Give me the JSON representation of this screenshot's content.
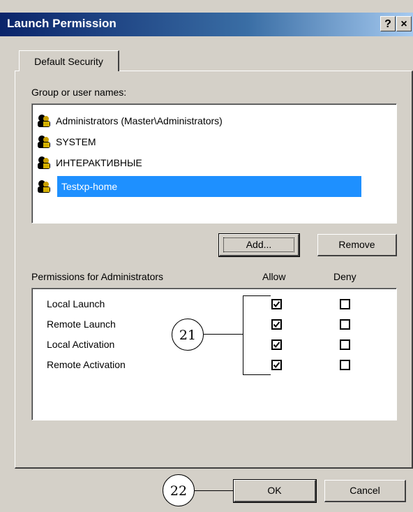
{
  "window": {
    "title": "Launch Permission",
    "help_button": "?",
    "close_button": "×"
  },
  "tabs": [
    {
      "label": "Default Security"
    }
  ],
  "group_label": "Group or user names:",
  "users": [
    {
      "name": "Administrators (Master\\Administrators)",
      "icon": "users-icon"
    },
    {
      "name": "SYSTEM",
      "icon": "users-icon"
    },
    {
      "name": "ИНТЕРАКТИВНЫЕ",
      "icon": "users-icon"
    },
    {
      "name": "Testxp-home",
      "icon": "users-icon",
      "selected": true
    }
  ],
  "buttons": {
    "add": "Add...",
    "remove": "Remove",
    "ok": "OK",
    "cancel": "Cancel"
  },
  "permissions": {
    "label": "Permissions for Administrators",
    "allow_header": "Allow",
    "deny_header": "Deny",
    "items": [
      {
        "name": "Local Launch",
        "allow": true,
        "deny": false
      },
      {
        "name": "Remote Launch",
        "allow": true,
        "deny": false
      },
      {
        "name": "Local Activation",
        "allow": true,
        "deny": false
      },
      {
        "name": "Remote Activation",
        "allow": true,
        "deny": false
      }
    ]
  },
  "callouts": [
    {
      "number": "21"
    },
    {
      "number": "22"
    }
  ]
}
